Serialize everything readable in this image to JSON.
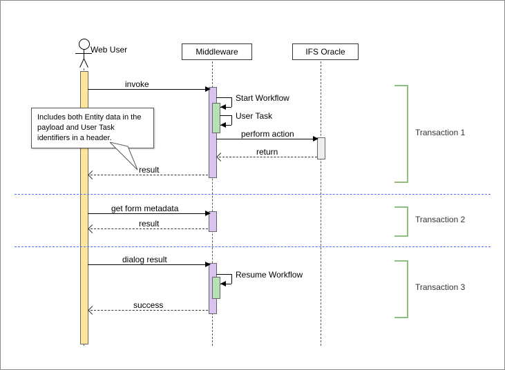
{
  "participants": {
    "webuser": {
      "label": "Web User"
    },
    "middleware": {
      "label": "Middleware"
    },
    "oracle": {
      "label": "IFS Oracle"
    }
  },
  "messages": {
    "invoke": "invoke",
    "start_workflow": "Start Workflow",
    "user_task": "User Task",
    "perform_action": "perform action",
    "return": "return",
    "result1": "result",
    "get_form": "get form metadata",
    "result2": "result",
    "dialog_result": "dialog result",
    "resume_workflow": "Resume Workflow",
    "success": "success"
  },
  "note": "Includes both Entity data in the payload and User Task identifiers in a header.",
  "transactions": {
    "t1": "Transaction 1",
    "t2": "Transaction 2",
    "t3": "Transaction 3"
  },
  "chart_data": {
    "type": "sequence-diagram",
    "participants": [
      "Web User",
      "Middleware",
      "IFS Oracle"
    ],
    "groups": [
      {
        "name": "Transaction 1",
        "messages": [
          {
            "from": "Web User",
            "to": "Middleware",
            "label": "invoke",
            "style": "sync"
          },
          {
            "from": "Middleware",
            "to": "Middleware",
            "label": "Start Workflow",
            "style": "self"
          },
          {
            "from": "Middleware",
            "to": "Middleware",
            "label": "User Task",
            "style": "self"
          },
          {
            "from": "Middleware",
            "to": "IFS Oracle",
            "label": "perform action",
            "style": "sync"
          },
          {
            "from": "IFS Oracle",
            "to": "Middleware",
            "label": "return",
            "style": "return"
          },
          {
            "from": "Middleware",
            "to": "Web User",
            "label": "result",
            "style": "return"
          }
        ]
      },
      {
        "name": "Transaction 2",
        "messages": [
          {
            "from": "Web User",
            "to": "Middleware",
            "label": "get form metadata",
            "style": "sync"
          },
          {
            "from": "Middleware",
            "to": "Web User",
            "label": "result",
            "style": "return"
          }
        ]
      },
      {
        "name": "Transaction 3",
        "messages": [
          {
            "from": "Web User",
            "to": "Middleware",
            "label": "dialog result",
            "style": "sync"
          },
          {
            "from": "Middleware",
            "to": "Middleware",
            "label": "Resume Workflow",
            "style": "self"
          },
          {
            "from": "Middleware",
            "to": "Web User",
            "label": "success",
            "style": "return"
          }
        ]
      }
    ],
    "note": {
      "attached_to": "result (Middleware→Web User)",
      "text": "Includes both Entity data in the payload and User Task identifiers in a header."
    }
  }
}
